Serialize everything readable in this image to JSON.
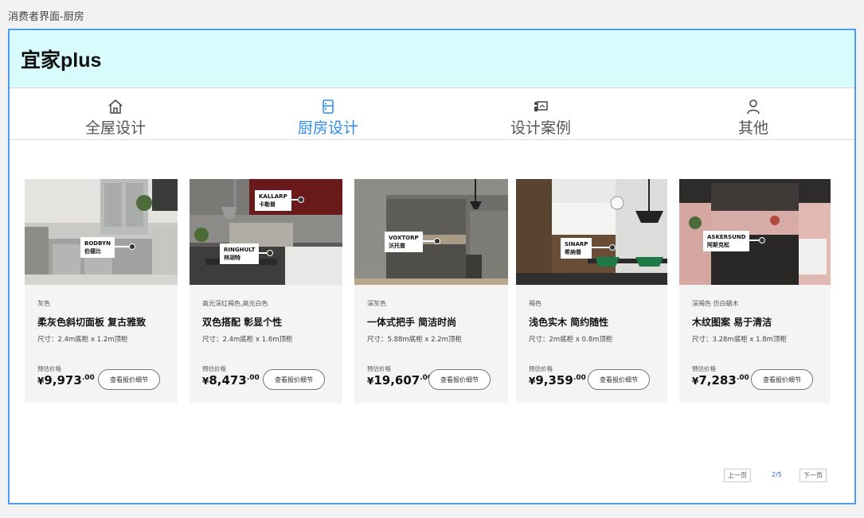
{
  "page_label": "消费者界面-厨房",
  "brand": "宜家plus",
  "nav": [
    {
      "label": "全屋设计",
      "icon": "home-icon"
    },
    {
      "label": "厨房设计",
      "icon": "cabinet-icon"
    },
    {
      "label": "设计案例",
      "icon": "design-board-icon"
    },
    {
      "label": "其他",
      "icon": "user-icon"
    }
  ],
  "active_nav": 1,
  "cards": [
    {
      "tag_en": "BODBYN",
      "tag_cn": "伯德比",
      "color": "灰色",
      "title": "柔灰色斜切面板 复古雅致",
      "size": "尺寸：2.4m底柜 x 1.2m顶柜",
      "est_label": "预估价格",
      "yen": "¥",
      "price": "9,973",
      "cents": ".00",
      "button": "查看报价细节"
    },
    {
      "tag_en": "RINGHULT",
      "tag_cn": "林胡特",
      "tag2_en": "KALLARP",
      "tag2_cn": "卡勒普",
      "color": "高光深红褐色,高光白色",
      "title": "双色搭配 彰显个性",
      "size": "尺寸：2.4m底柜 x 1.6m顶柜",
      "est_label": "预估价格",
      "yen": "¥",
      "price": "8,473",
      "cents": ".00",
      "button": "查看报价细节"
    },
    {
      "tag_en": "VOXTORP",
      "tag_cn": "沃托普",
      "color": "深灰色",
      "title": "一体式把手 简洁时尚",
      "size": "尺寸：5.88m底柜 x 2.2m顶柜",
      "est_label": "预估价格",
      "yen": "¥",
      "price": "19,607",
      "cents": ".00",
      "button": "查看报价细节"
    },
    {
      "tag_en": "SINARP",
      "tag_cn": "希纳普",
      "color": "褐色",
      "title": "浅色实木 简约随性",
      "size": "尺寸：2m底柜 x 0.8m顶柜",
      "est_label": "预估价格",
      "yen": "¥",
      "price": "9,359",
      "cents": ".00",
      "button": "查看报价细节"
    },
    {
      "tag_en": "ASKERSUND",
      "tag_cn": "阿斯克松",
      "color": "深褐色 仿白蜡木",
      "title": "木纹图案 易于清洁",
      "size": "尺寸：3.28m底柜 x 1.8m顶柜",
      "est_label": "预估价格",
      "yen": "¥",
      "price": "7,283",
      "cents": ".00",
      "button": "查看报价细节"
    }
  ],
  "pager": {
    "prev": "上一页",
    "current": "2/5",
    "next": "下一页"
  },
  "colors": {
    "accent": "#2d8cf0",
    "frame_border": "#4f9bf0",
    "header_bg": "#d8fbfe"
  }
}
